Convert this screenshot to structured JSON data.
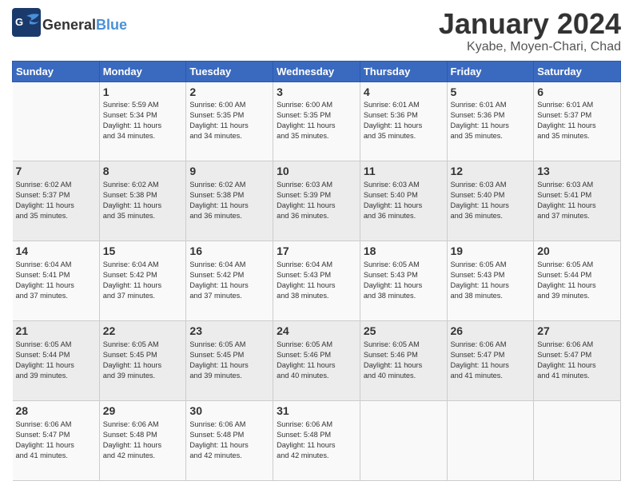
{
  "header": {
    "logo_general": "General",
    "logo_blue": "Blue",
    "month_title": "January 2024",
    "location": "Kyabe, Moyen-Chari, Chad"
  },
  "days_of_week": [
    "Sunday",
    "Monday",
    "Tuesday",
    "Wednesday",
    "Thursday",
    "Friday",
    "Saturday"
  ],
  "weeks": [
    [
      {
        "day": null,
        "data": null
      },
      {
        "day": "1",
        "data": [
          "Sunrise: 5:59 AM",
          "Sunset: 5:34 PM",
          "Daylight: 11 hours",
          "and 34 minutes."
        ]
      },
      {
        "day": "2",
        "data": [
          "Sunrise: 6:00 AM",
          "Sunset: 5:35 PM",
          "Daylight: 11 hours",
          "and 34 minutes."
        ]
      },
      {
        "day": "3",
        "data": [
          "Sunrise: 6:00 AM",
          "Sunset: 5:35 PM",
          "Daylight: 11 hours",
          "and 35 minutes."
        ]
      },
      {
        "day": "4",
        "data": [
          "Sunrise: 6:01 AM",
          "Sunset: 5:36 PM",
          "Daylight: 11 hours",
          "and 35 minutes."
        ]
      },
      {
        "day": "5",
        "data": [
          "Sunrise: 6:01 AM",
          "Sunset: 5:36 PM",
          "Daylight: 11 hours",
          "and 35 minutes."
        ]
      },
      {
        "day": "6",
        "data": [
          "Sunrise: 6:01 AM",
          "Sunset: 5:37 PM",
          "Daylight: 11 hours",
          "and 35 minutes."
        ]
      }
    ],
    [
      {
        "day": "7",
        "data": [
          "Sunrise: 6:02 AM",
          "Sunset: 5:37 PM",
          "Daylight: 11 hours",
          "and 35 minutes."
        ]
      },
      {
        "day": "8",
        "data": [
          "Sunrise: 6:02 AM",
          "Sunset: 5:38 PM",
          "Daylight: 11 hours",
          "and 35 minutes."
        ]
      },
      {
        "day": "9",
        "data": [
          "Sunrise: 6:02 AM",
          "Sunset: 5:38 PM",
          "Daylight: 11 hours",
          "and 36 minutes."
        ]
      },
      {
        "day": "10",
        "data": [
          "Sunrise: 6:03 AM",
          "Sunset: 5:39 PM",
          "Daylight: 11 hours",
          "and 36 minutes."
        ]
      },
      {
        "day": "11",
        "data": [
          "Sunrise: 6:03 AM",
          "Sunset: 5:40 PM",
          "Daylight: 11 hours",
          "and 36 minutes."
        ]
      },
      {
        "day": "12",
        "data": [
          "Sunrise: 6:03 AM",
          "Sunset: 5:40 PM",
          "Daylight: 11 hours",
          "and 36 minutes."
        ]
      },
      {
        "day": "13",
        "data": [
          "Sunrise: 6:03 AM",
          "Sunset: 5:41 PM",
          "Daylight: 11 hours",
          "and 37 minutes."
        ]
      }
    ],
    [
      {
        "day": "14",
        "data": [
          "Sunrise: 6:04 AM",
          "Sunset: 5:41 PM",
          "Daylight: 11 hours",
          "and 37 minutes."
        ]
      },
      {
        "day": "15",
        "data": [
          "Sunrise: 6:04 AM",
          "Sunset: 5:42 PM",
          "Daylight: 11 hours",
          "and 37 minutes."
        ]
      },
      {
        "day": "16",
        "data": [
          "Sunrise: 6:04 AM",
          "Sunset: 5:42 PM",
          "Daylight: 11 hours",
          "and 37 minutes."
        ]
      },
      {
        "day": "17",
        "data": [
          "Sunrise: 6:04 AM",
          "Sunset: 5:43 PM",
          "Daylight: 11 hours",
          "and 38 minutes."
        ]
      },
      {
        "day": "18",
        "data": [
          "Sunrise: 6:05 AM",
          "Sunset: 5:43 PM",
          "Daylight: 11 hours",
          "and 38 minutes."
        ]
      },
      {
        "day": "19",
        "data": [
          "Sunrise: 6:05 AM",
          "Sunset: 5:43 PM",
          "Daylight: 11 hours",
          "and 38 minutes."
        ]
      },
      {
        "day": "20",
        "data": [
          "Sunrise: 6:05 AM",
          "Sunset: 5:44 PM",
          "Daylight: 11 hours",
          "and 39 minutes."
        ]
      }
    ],
    [
      {
        "day": "21",
        "data": [
          "Sunrise: 6:05 AM",
          "Sunset: 5:44 PM",
          "Daylight: 11 hours",
          "and 39 minutes."
        ]
      },
      {
        "day": "22",
        "data": [
          "Sunrise: 6:05 AM",
          "Sunset: 5:45 PM",
          "Daylight: 11 hours",
          "and 39 minutes."
        ]
      },
      {
        "day": "23",
        "data": [
          "Sunrise: 6:05 AM",
          "Sunset: 5:45 PM",
          "Daylight: 11 hours",
          "and 39 minutes."
        ]
      },
      {
        "day": "24",
        "data": [
          "Sunrise: 6:05 AM",
          "Sunset: 5:46 PM",
          "Daylight: 11 hours",
          "and 40 minutes."
        ]
      },
      {
        "day": "25",
        "data": [
          "Sunrise: 6:05 AM",
          "Sunset: 5:46 PM",
          "Daylight: 11 hours",
          "and 40 minutes."
        ]
      },
      {
        "day": "26",
        "data": [
          "Sunrise: 6:06 AM",
          "Sunset: 5:47 PM",
          "Daylight: 11 hours",
          "and 41 minutes."
        ]
      },
      {
        "day": "27",
        "data": [
          "Sunrise: 6:06 AM",
          "Sunset: 5:47 PM",
          "Daylight: 11 hours",
          "and 41 minutes."
        ]
      }
    ],
    [
      {
        "day": "28",
        "data": [
          "Sunrise: 6:06 AM",
          "Sunset: 5:47 PM",
          "Daylight: 11 hours",
          "and 41 minutes."
        ]
      },
      {
        "day": "29",
        "data": [
          "Sunrise: 6:06 AM",
          "Sunset: 5:48 PM",
          "Daylight: 11 hours",
          "and 42 minutes."
        ]
      },
      {
        "day": "30",
        "data": [
          "Sunrise: 6:06 AM",
          "Sunset: 5:48 PM",
          "Daylight: 11 hours",
          "and 42 minutes."
        ]
      },
      {
        "day": "31",
        "data": [
          "Sunrise: 6:06 AM",
          "Sunset: 5:48 PM",
          "Daylight: 11 hours",
          "and 42 minutes."
        ]
      },
      {
        "day": null,
        "data": null
      },
      {
        "day": null,
        "data": null
      },
      {
        "day": null,
        "data": null
      }
    ]
  ]
}
